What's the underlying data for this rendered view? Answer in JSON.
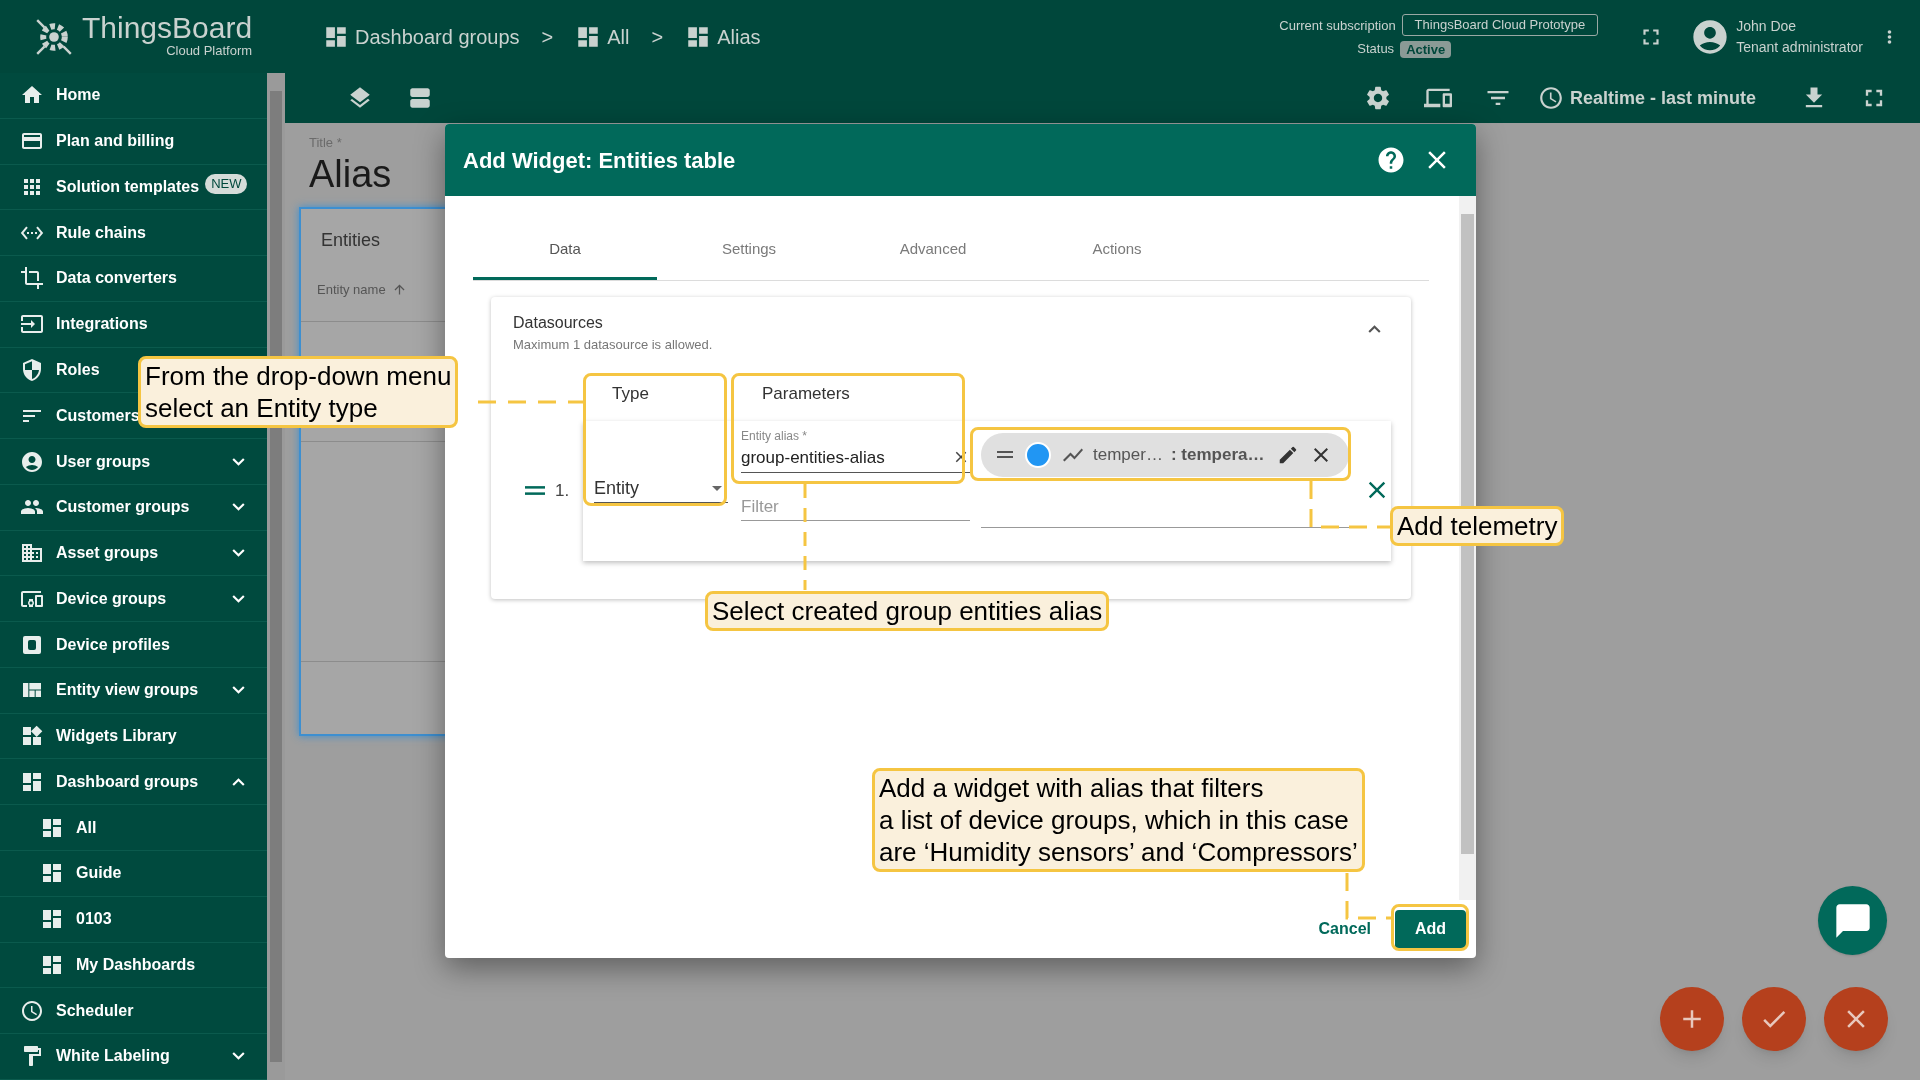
{
  "header": {
    "logo_title": "ThingsBoard",
    "logo_subtitle": "Cloud Platform",
    "breadcrumbs": [
      {
        "label": "Dashboard groups"
      },
      {
        "label": "All"
      },
      {
        "label": "Alias"
      }
    ],
    "separators": [
      ">",
      ">"
    ],
    "subscription_label": "Current subscription",
    "subscription": "ThingsBoard Cloud Prototype",
    "status_label": "Status",
    "status": "Active",
    "user_name": "John Doe",
    "user_role": "Tenant administrator"
  },
  "toolbar": {
    "timewindow": "Realtime - last minute"
  },
  "sidebar": {
    "items": [
      {
        "label": "Home"
      },
      {
        "label": "Plan and billing"
      },
      {
        "label": "Solution templates",
        "badge": "NEW"
      },
      {
        "label": "Rule chains"
      },
      {
        "label": "Data converters"
      },
      {
        "label": "Integrations"
      },
      {
        "label": "Roles"
      },
      {
        "label": "Customers"
      },
      {
        "label": "User groups",
        "expanded": false
      },
      {
        "label": "Customer groups",
        "expanded": false
      },
      {
        "label": "Asset groups",
        "expanded": false
      },
      {
        "label": "Device groups",
        "expanded": false
      },
      {
        "label": "Device profiles"
      },
      {
        "label": "Entity view groups",
        "expanded": false
      },
      {
        "label": "Widgets Library"
      },
      {
        "label": "Dashboard groups",
        "expanded": true,
        "children": [
          {
            "label": "All"
          },
          {
            "label": "Guide"
          },
          {
            "label": "0103"
          },
          {
            "label": "My Dashboards"
          }
        ]
      },
      {
        "label": "Scheduler"
      },
      {
        "label": "White Labeling",
        "expanded": false
      }
    ]
  },
  "page": {
    "title_label": "Title *",
    "title": "Alias",
    "card": {
      "title": "Entities",
      "column": "Entity name"
    }
  },
  "dialog": {
    "title": "Add Widget: Entities table",
    "tabs": [
      {
        "label": "Data",
        "selected": true
      },
      {
        "label": "Settings",
        "selected": false
      },
      {
        "label": "Advanced",
        "selected": false
      },
      {
        "label": "Actions",
        "selected": false
      }
    ],
    "datasources": {
      "title": "Datasources",
      "hint": "Maximum 1 datasource is allowed.",
      "expanded": true,
      "type_header": "Type",
      "params_header": "Parameters",
      "rows": [
        {
          "index": "1.",
          "type": "Entity",
          "alias_label": "Entity alias *",
          "alias": "group-entities-alias",
          "filter_placeholder": "Filter",
          "keys": [
            {
              "label": "temper…",
              "name": ": tempera…",
              "color": "#2196f3"
            }
          ]
        }
      ]
    },
    "buttons": {
      "cancel": "Cancel",
      "add": "Add"
    }
  },
  "callouts": [
    {
      "text": "From the drop-down menu\nselect an Entity type"
    },
    {
      "text": "Add telemetry"
    },
    {
      "text": "Select created group entities alias"
    },
    {
      "text": "Add a widget with alias that filters\na list of device groups, which in this case\nare ‘Humidity sensors’ and ‘Compressors’"
    }
  ]
}
